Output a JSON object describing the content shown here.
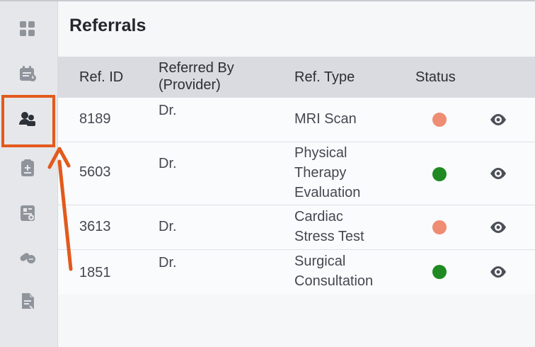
{
  "page": {
    "title": "Referrals"
  },
  "colors": {
    "accent_orange": "#e25a1c",
    "status_pending": "#ef8c74",
    "status_complete": "#1f8a22"
  },
  "sidebar": {
    "items": [
      {
        "name": "dashboard-icon",
        "active": false
      },
      {
        "name": "appointments-icon",
        "active": false
      },
      {
        "name": "referrals-icon",
        "active": true
      },
      {
        "name": "clipboard-icon",
        "active": false
      },
      {
        "name": "records-icon",
        "active": false
      },
      {
        "name": "medication-icon",
        "active": false
      },
      {
        "name": "document-icon",
        "active": false
      }
    ]
  },
  "table": {
    "headers": {
      "ref_id": "Ref. ID",
      "referred_by_line1": "Referred By",
      "referred_by_line2": "(Provider)",
      "ref_type": "Ref. Type",
      "status": "Status"
    },
    "rows": [
      {
        "ref_id": "8189",
        "provider": "Dr.",
        "ref_type_lines": [
          "MRI Scan"
        ],
        "status": "pending",
        "status_color": "#ef8c74"
      },
      {
        "ref_id": "5603",
        "provider": "Dr.",
        "ref_type_lines": [
          "Physical",
          "Therapy",
          "Evaluation"
        ],
        "status": "complete",
        "status_color": "#1f8a22"
      },
      {
        "ref_id": "3613",
        "provider": "Dr.",
        "ref_type_lines": [
          "Cardiac",
          "Stress Test"
        ],
        "status": "pending",
        "status_color": "#ef8c74"
      },
      {
        "ref_id": "1851",
        "provider": "Dr.",
        "ref_type_lines": [
          "Surgical",
          "Consultation"
        ],
        "status": "complete",
        "status_color": "#1f8a22"
      }
    ]
  }
}
